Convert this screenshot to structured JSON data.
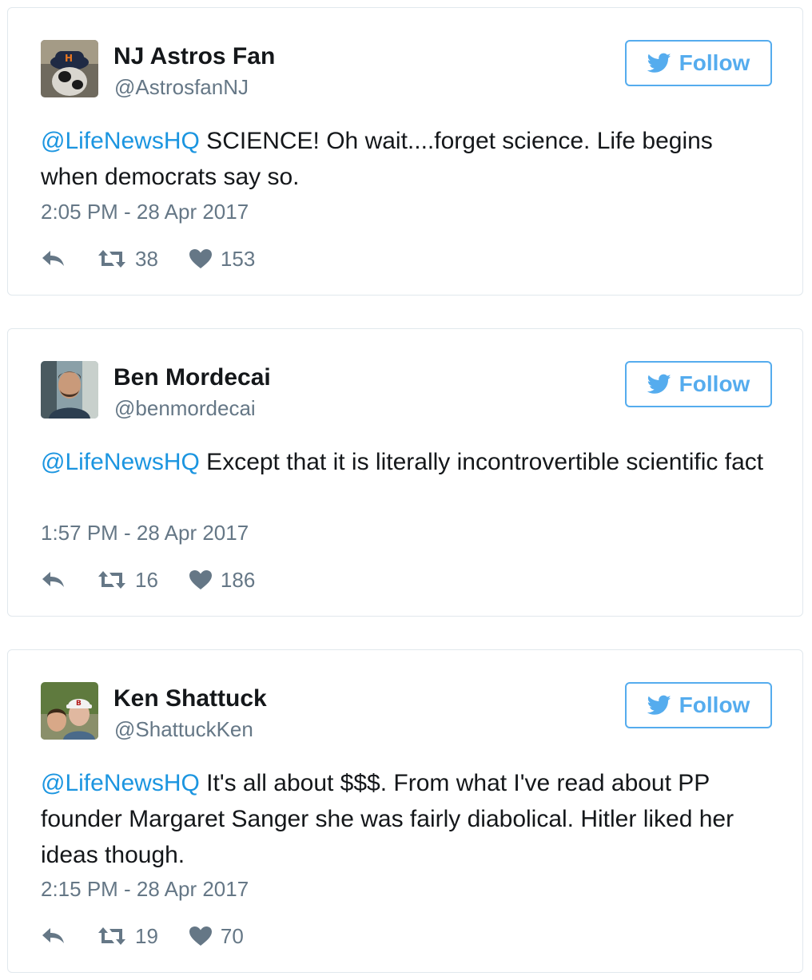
{
  "follow_label": "Follow",
  "tweets": [
    {
      "name": "NJ Astros Fan",
      "handle": "@AstrosfanNJ",
      "mention": "@LifeNewsHQ",
      "text": " SCIENCE! Oh wait....forget science. Life begins when democrats say so.",
      "timestamp": "2:05 PM - 28 Apr 2017",
      "retweets": "38",
      "likes": "153"
    },
    {
      "name": "Ben Mordecai",
      "handle": "@benmordecai",
      "mention": "@LifeNewsHQ",
      "text": " Except that it is literally incontrovertible scientific fact",
      "timestamp": "1:57 PM - 28 Apr 2017",
      "retweets": "16",
      "likes": "186"
    },
    {
      "name": "Ken Shattuck",
      "handle": "@ShattuckKen",
      "mention": "@LifeNewsHQ",
      "text": " It's all about $$$. From what I've read about PP founder Margaret Sanger she was fairly diabolical. Hitler liked her ideas though.",
      "timestamp": "2:15 PM - 28 Apr 2017",
      "retweets": "19",
      "likes": "70"
    }
  ],
  "colors": {
    "accent": "#55acee",
    "link": "#1b95e0",
    "muted": "#657786",
    "border": "#e1e8ed"
  },
  "icons": [
    "reply-icon",
    "retweet-icon",
    "heart-icon",
    "twitter-bird-icon"
  ]
}
